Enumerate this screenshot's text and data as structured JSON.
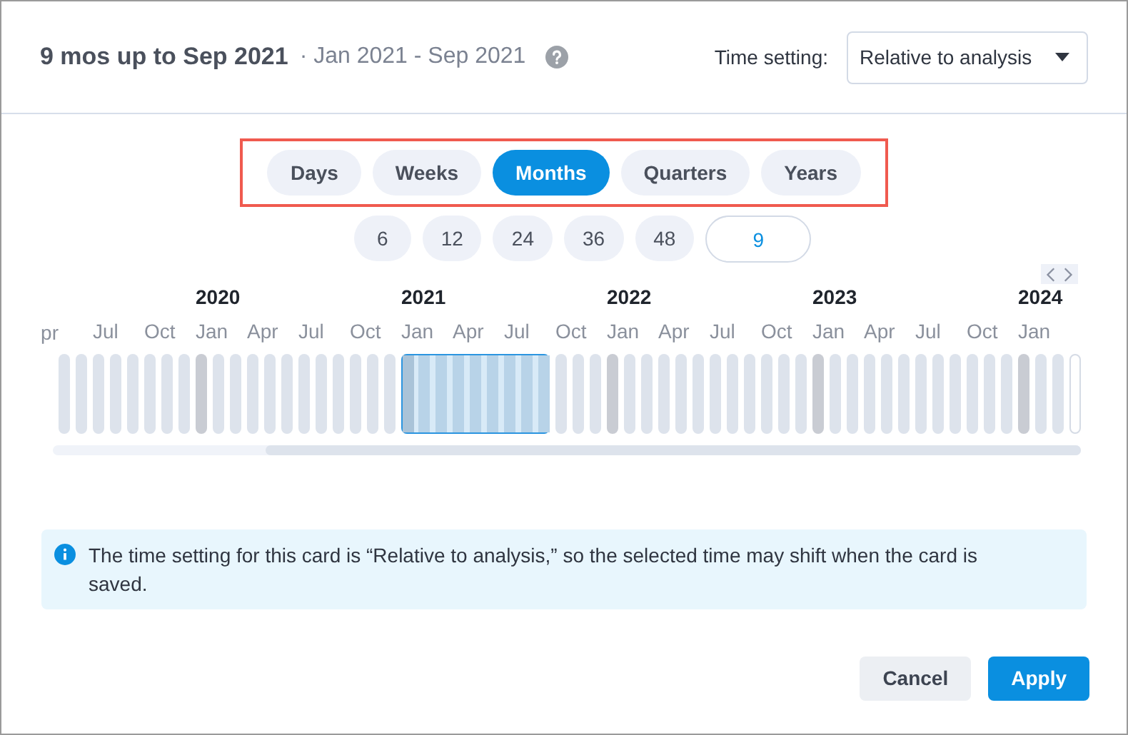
{
  "header": {
    "title": "9 mos up to Sep 2021",
    "range": "· Jan 2021 - Sep 2021",
    "time_setting_label": "Time setting:",
    "time_setting_value": "Relative to analysis"
  },
  "granularity": [
    {
      "label": "Days",
      "selected": false
    },
    {
      "label": "Weeks",
      "selected": false
    },
    {
      "label": "Months",
      "selected": true
    },
    {
      "label": "Quarters",
      "selected": false
    },
    {
      "label": "Years",
      "selected": false
    }
  ],
  "presets": [
    "6",
    "12",
    "24",
    "36",
    "48"
  ],
  "custom_count": "9",
  "timeline": {
    "leading_label": "pr",
    "bars": [
      {
        "kind": "regular",
        "selected": false
      },
      {
        "kind": "regular",
        "selected": false
      },
      {
        "kind": "regular",
        "selected": false,
        "month": "Jul"
      },
      {
        "kind": "regular",
        "selected": false
      },
      {
        "kind": "regular",
        "selected": false
      },
      {
        "kind": "regular",
        "selected": false,
        "month": "Oct"
      },
      {
        "kind": "regular",
        "selected": false
      },
      {
        "kind": "regular",
        "selected": false
      },
      {
        "kind": "year_start",
        "selected": false,
        "month": "Jan",
        "year": "2020"
      },
      {
        "kind": "regular",
        "selected": false
      },
      {
        "kind": "regular",
        "selected": false
      },
      {
        "kind": "regular",
        "selected": false,
        "month": "Apr"
      },
      {
        "kind": "regular",
        "selected": false
      },
      {
        "kind": "regular",
        "selected": false
      },
      {
        "kind": "regular",
        "selected": false,
        "month": "Jul"
      },
      {
        "kind": "regular",
        "selected": false
      },
      {
        "kind": "regular",
        "selected": false
      },
      {
        "kind": "regular",
        "selected": false,
        "month": "Oct"
      },
      {
        "kind": "regular",
        "selected": false
      },
      {
        "kind": "regular",
        "selected": false
      },
      {
        "kind": "year_start",
        "selected": true,
        "month": "Jan",
        "year": "2021"
      },
      {
        "kind": "regular",
        "selected": true
      },
      {
        "kind": "regular",
        "selected": true
      },
      {
        "kind": "regular",
        "selected": true,
        "month": "Apr"
      },
      {
        "kind": "regular",
        "selected": true
      },
      {
        "kind": "regular",
        "selected": true
      },
      {
        "kind": "regular",
        "selected": true,
        "month": "Jul"
      },
      {
        "kind": "regular",
        "selected": true
      },
      {
        "kind": "regular",
        "selected": true
      },
      {
        "kind": "regular",
        "selected": false,
        "month": "Oct"
      },
      {
        "kind": "regular",
        "selected": false
      },
      {
        "kind": "regular",
        "selected": false
      },
      {
        "kind": "year_start",
        "selected": false,
        "month": "Jan",
        "year": "2022"
      },
      {
        "kind": "regular",
        "selected": false
      },
      {
        "kind": "regular",
        "selected": false
      },
      {
        "kind": "regular",
        "selected": false,
        "month": "Apr"
      },
      {
        "kind": "regular",
        "selected": false
      },
      {
        "kind": "regular",
        "selected": false
      },
      {
        "kind": "regular",
        "selected": false,
        "month": "Jul"
      },
      {
        "kind": "regular",
        "selected": false
      },
      {
        "kind": "regular",
        "selected": false
      },
      {
        "kind": "regular",
        "selected": false,
        "month": "Oct"
      },
      {
        "kind": "regular",
        "selected": false
      },
      {
        "kind": "regular",
        "selected": false
      },
      {
        "kind": "year_start",
        "selected": false,
        "month": "Jan",
        "year": "2023"
      },
      {
        "kind": "regular",
        "selected": false
      },
      {
        "kind": "regular",
        "selected": false
      },
      {
        "kind": "regular",
        "selected": false,
        "month": "Apr"
      },
      {
        "kind": "regular",
        "selected": false
      },
      {
        "kind": "regular",
        "selected": false
      },
      {
        "kind": "regular",
        "selected": false,
        "month": "Jul"
      },
      {
        "kind": "regular",
        "selected": false
      },
      {
        "kind": "regular",
        "selected": false
      },
      {
        "kind": "regular",
        "selected": false,
        "month": "Oct"
      },
      {
        "kind": "regular",
        "selected": false
      },
      {
        "kind": "regular",
        "selected": false
      },
      {
        "kind": "year_start",
        "selected": false,
        "month": "Jan",
        "year": "2024"
      },
      {
        "kind": "regular",
        "selected": false
      },
      {
        "kind": "regular",
        "selected": false
      },
      {
        "kind": "future",
        "selected": false
      }
    ]
  },
  "notice": "The time setting for this card is “Relative to analysis,” so the selected time may shift when the card is saved.",
  "buttons": [
    {
      "label": "Cancel",
      "kind": "secondary"
    },
    {
      "label": "Apply",
      "kind": "primary"
    }
  ]
}
